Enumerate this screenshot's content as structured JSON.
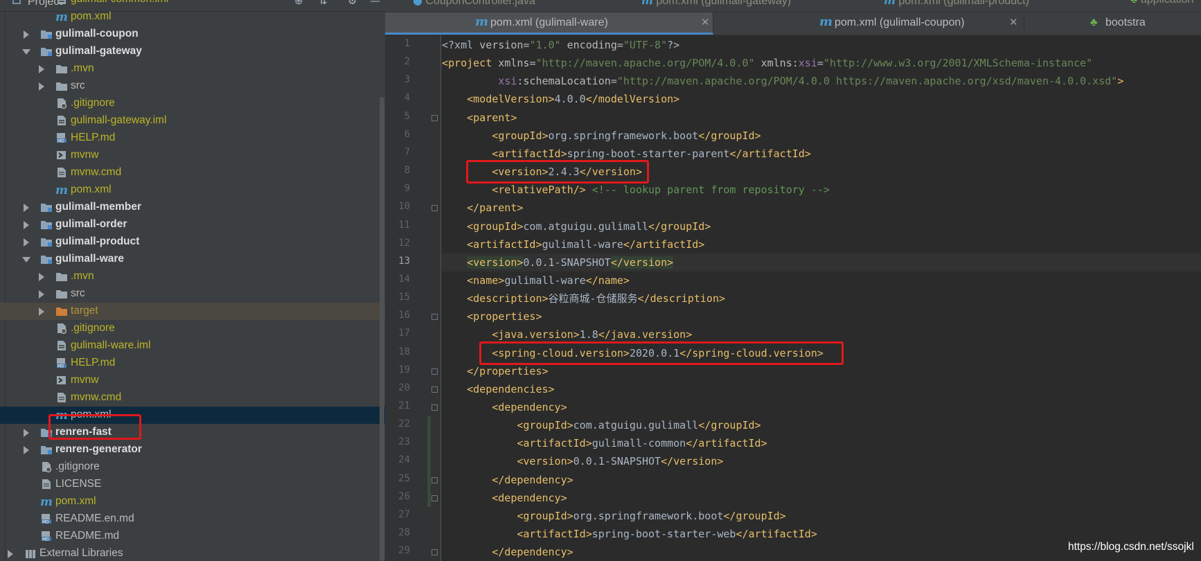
{
  "project_panel": {
    "title": "Project",
    "tree": [
      {
        "label": "gulimall-common.iml",
        "color": "yellow",
        "icon": "iml-file-icon",
        "indent": 2
      },
      {
        "label": "pom.xml",
        "color": "yellow",
        "icon": "maven-m-icon",
        "indent": 2
      },
      {
        "label": "gulimall-coupon",
        "color": "bold",
        "icon": "module-folder-icon",
        "arrow": "closed",
        "indent": 1
      },
      {
        "label": "gulimall-gateway",
        "color": "bold",
        "icon": "module-folder-icon",
        "arrow": "open",
        "indent": 1
      },
      {
        "label": ".mvn",
        "color": "yellow",
        "icon": "folder-icon",
        "arrow": "closed",
        "indent": 2
      },
      {
        "label": "src",
        "color": "default",
        "icon": "folder-icon",
        "arrow": "closed",
        "indent": 2
      },
      {
        "label": ".gitignore",
        "color": "yellow",
        "icon": "gitignore-file-icon",
        "indent": 2
      },
      {
        "label": "gulimall-gateway.iml",
        "color": "yellow",
        "icon": "iml-file-icon",
        "indent": 2
      },
      {
        "label": "HELP.md",
        "color": "yellow",
        "icon": "markdown-file-icon",
        "indent": 2
      },
      {
        "label": "mvnw",
        "color": "yellow",
        "icon": "script-file-icon",
        "indent": 2
      },
      {
        "label": "mvnw.cmd",
        "color": "yellow",
        "icon": "text-file-icon",
        "indent": 2
      },
      {
        "label": "pom.xml",
        "color": "yellow",
        "icon": "maven-m-icon",
        "indent": 2
      },
      {
        "label": "gulimall-member",
        "color": "bold",
        "icon": "module-folder-icon",
        "arrow": "closed",
        "indent": 1
      },
      {
        "label": "gulimall-order",
        "color": "bold",
        "icon": "module-folder-icon",
        "arrow": "closed",
        "indent": 1
      },
      {
        "label": "gulimall-product",
        "color": "bold",
        "icon": "module-folder-icon",
        "arrow": "closed",
        "indent": 1
      },
      {
        "label": "gulimall-ware",
        "color": "bold",
        "icon": "module-folder-icon",
        "arrow": "open",
        "indent": 1
      },
      {
        "label": ".mvn",
        "color": "yellow",
        "icon": "folder-icon",
        "arrow": "closed",
        "indent": 2
      },
      {
        "label": "src",
        "color": "default",
        "icon": "folder-icon",
        "arrow": "closed",
        "indent": 2
      },
      {
        "label": "target",
        "color": "gold",
        "icon": "excluded-folder-icon",
        "arrow": "closed",
        "indent": 2,
        "highlight": true
      },
      {
        "label": ".gitignore",
        "color": "yellow",
        "icon": "gitignore-file-icon",
        "indent": 2
      },
      {
        "label": "gulimall-ware.iml",
        "color": "yellow",
        "icon": "iml-file-icon",
        "indent": 2
      },
      {
        "label": "HELP.md",
        "color": "yellow",
        "icon": "markdown-file-icon",
        "indent": 2
      },
      {
        "label": "mvnw",
        "color": "yellow",
        "icon": "script-file-icon",
        "indent": 2
      },
      {
        "label": "mvnw.cmd",
        "color": "yellow",
        "icon": "text-file-icon",
        "indent": 2
      },
      {
        "label": "pom.xml",
        "color": "default",
        "icon": "maven-m-icon",
        "indent": 2,
        "selected": true
      },
      {
        "label": "renren-fast",
        "color": "bold",
        "icon": "module-folder-icon",
        "arrow": "closed",
        "indent": 1
      },
      {
        "label": "renren-generator",
        "color": "bold",
        "icon": "module-folder-icon",
        "arrow": "closed",
        "indent": 1
      },
      {
        "label": ".gitignore",
        "color": "default",
        "icon": "gitignore-file-icon",
        "indent": 1
      },
      {
        "label": "LICENSE",
        "color": "default",
        "icon": "text-file-icon",
        "indent": 1
      },
      {
        "label": "pom.xml",
        "color": "yellow",
        "icon": "maven-m-icon",
        "indent": 1
      },
      {
        "label": "README.en.md",
        "color": "default",
        "icon": "markdown-file-icon",
        "indent": 1
      },
      {
        "label": "README.md",
        "color": "default",
        "icon": "markdown-file-icon",
        "indent": 1
      },
      {
        "label": "External Libraries",
        "color": "default",
        "icon": "library-icon",
        "arrow": "closed",
        "indent": 0
      }
    ]
  },
  "tabs_top": [
    {
      "label": "CouponController.java"
    },
    {
      "label": "pom.xml (gulimall-gateway)"
    },
    {
      "label": "pom.xml (gulimall-product)"
    },
    {
      "label": "application"
    }
  ],
  "tabs": [
    {
      "label": "pom.xml (gulimall-ware)",
      "active": true
    },
    {
      "label": "pom.xml (gulimall-coupon)",
      "active": false
    },
    {
      "label": "bootstra",
      "active": false
    }
  ],
  "editor": {
    "current_line": 13,
    "lines": [
      [
        [
          "t",
          "<?xml "
        ],
        [
          "a",
          "version"
        ],
        [
          "t",
          "="
        ],
        [
          "s",
          "\"1.0\""
        ],
        [
          "a",
          " encoding"
        ],
        [
          "t",
          "="
        ],
        [
          "s",
          "\"UTF-8\""
        ],
        [
          "t",
          "?>"
        ]
      ],
      [
        [
          "g",
          "<project "
        ],
        [
          "a",
          "xmlns"
        ],
        [
          "t",
          "="
        ],
        [
          "s",
          "\"http://maven.apache.org/POM/4.0.0\""
        ],
        [
          "a",
          " xmlns"
        ],
        [
          "t",
          ":"
        ],
        [
          "n",
          "xsi"
        ],
        [
          "t",
          "="
        ],
        [
          "s",
          "\"http://www.w3.org/2001/XMLSchema-instance\""
        ]
      ],
      [
        [
          "t",
          "         "
        ],
        [
          "n",
          "xsi"
        ],
        [
          "t",
          ":"
        ],
        [
          "a",
          "schemaLocation"
        ],
        [
          "t",
          "="
        ],
        [
          "s",
          "\"http://maven.apache.org/POM/4.0.0 https://maven.apache.org/xsd/maven-4.0.0.xsd\""
        ],
        [
          "g",
          ">"
        ]
      ],
      [
        [
          "t",
          "    "
        ],
        [
          "g",
          "<modelVersion>"
        ],
        [
          "t",
          "4.0.0"
        ],
        [
          "g",
          "</modelVersion>"
        ]
      ],
      [
        [
          "t",
          "    "
        ],
        [
          "g",
          "<parent>"
        ]
      ],
      [
        [
          "t",
          "        "
        ],
        [
          "g",
          "<groupId>"
        ],
        [
          "t",
          "org.springframework.boot"
        ],
        [
          "g",
          "</groupId>"
        ]
      ],
      [
        [
          "t",
          "        "
        ],
        [
          "g",
          "<artifactId>"
        ],
        [
          "t",
          "spring-boot-starter-parent"
        ],
        [
          "g",
          "</artifactId>"
        ]
      ],
      [
        [
          "t",
          "        "
        ],
        [
          "g",
          "<version>"
        ],
        [
          "t",
          "2.4.3"
        ],
        [
          "g",
          "</version>"
        ]
      ],
      [
        [
          "t",
          "        "
        ],
        [
          "g",
          "<relativePath/>"
        ],
        [
          "t",
          " "
        ],
        [
          "c",
          "<!-- lookup parent from repository -->"
        ]
      ],
      [
        [
          "t",
          "    "
        ],
        [
          "g",
          "</parent>"
        ]
      ],
      [
        [
          "t",
          "    "
        ],
        [
          "g",
          "<groupId>"
        ],
        [
          "t",
          "com.atguigu.gulimall"
        ],
        [
          "g",
          "</groupId>"
        ]
      ],
      [
        [
          "t",
          "    "
        ],
        [
          "g",
          "<artifactId>"
        ],
        [
          "t",
          "gulimall-ware"
        ],
        [
          "g",
          "</artifactId>"
        ]
      ],
      [
        [
          "t",
          "    "
        ],
        [
          "gb",
          "<version>"
        ],
        [
          "t",
          "0.0.1-SNAPSHOT"
        ],
        [
          "gb",
          "</version>"
        ]
      ],
      [
        [
          "t",
          "    "
        ],
        [
          "g",
          "<name>"
        ],
        [
          "t",
          "gulimall-ware"
        ],
        [
          "g",
          "</name>"
        ]
      ],
      [
        [
          "t",
          "    "
        ],
        [
          "g",
          "<description>"
        ],
        [
          "t",
          "谷粒商城-仓储服务"
        ],
        [
          "g",
          "</description>"
        ]
      ],
      [
        [
          "t",
          "    "
        ],
        [
          "g",
          "<properties>"
        ]
      ],
      [
        [
          "t",
          "        "
        ],
        [
          "g",
          "<java.version>"
        ],
        [
          "t",
          "1.8"
        ],
        [
          "g",
          "</java.version>"
        ]
      ],
      [
        [
          "t",
          "        "
        ],
        [
          "g",
          "<spring-cloud.version>"
        ],
        [
          "t",
          "2020.0.1"
        ],
        [
          "g",
          "</spring-cloud.version>"
        ]
      ],
      [
        [
          "t",
          "    "
        ],
        [
          "g",
          "</properties>"
        ]
      ],
      [
        [
          "t",
          "    "
        ],
        [
          "g",
          "<dependencies>"
        ]
      ],
      [
        [
          "t",
          "        "
        ],
        [
          "g",
          "<dependency>"
        ]
      ],
      [
        [
          "t",
          "            "
        ],
        [
          "g",
          "<groupId>"
        ],
        [
          "t",
          "com.atguigu.gulimall"
        ],
        [
          "g",
          "</groupId>"
        ]
      ],
      [
        [
          "t",
          "            "
        ],
        [
          "g",
          "<artifactId>"
        ],
        [
          "t",
          "gulimall-common"
        ],
        [
          "g",
          "</artifactId>"
        ]
      ],
      [
        [
          "t",
          "            "
        ],
        [
          "g",
          "<version>"
        ],
        [
          "t",
          "0.0.1-SNAPSHOT"
        ],
        [
          "g",
          "</version>"
        ]
      ],
      [
        [
          "t",
          "        "
        ],
        [
          "g",
          "</dependency>"
        ]
      ],
      [
        [
          "t",
          "        "
        ],
        [
          "g",
          "<dependency>"
        ]
      ],
      [
        [
          "t",
          "            "
        ],
        [
          "g",
          "<groupId>"
        ],
        [
          "t",
          "org.springframework.boot"
        ],
        [
          "g",
          "</groupId>"
        ]
      ],
      [
        [
          "t",
          "            "
        ],
        [
          "g",
          "<artifactId>"
        ],
        [
          "t",
          "spring-boot-starter-web"
        ],
        [
          "g",
          "</artifactId>"
        ]
      ],
      [
        [
          "t",
          "        "
        ],
        [
          "g",
          "</dependency>"
        ]
      ]
    ],
    "fold_markers": [
      5,
      10,
      16,
      19,
      20,
      21,
      25,
      26,
      29
    ],
    "highlight_boxes": [
      8,
      18
    ]
  },
  "watermark": "https://blog.csdn.net/ssojkl",
  "colors": {
    "tag": "#e8bf6a",
    "attribute": "#bababa",
    "namespace": "#9876aa",
    "string": "#6a8759",
    "comment": "#629755",
    "text": "#a9b7c6",
    "annotation_box": "#e0191c",
    "selection": "#0d293e"
  }
}
